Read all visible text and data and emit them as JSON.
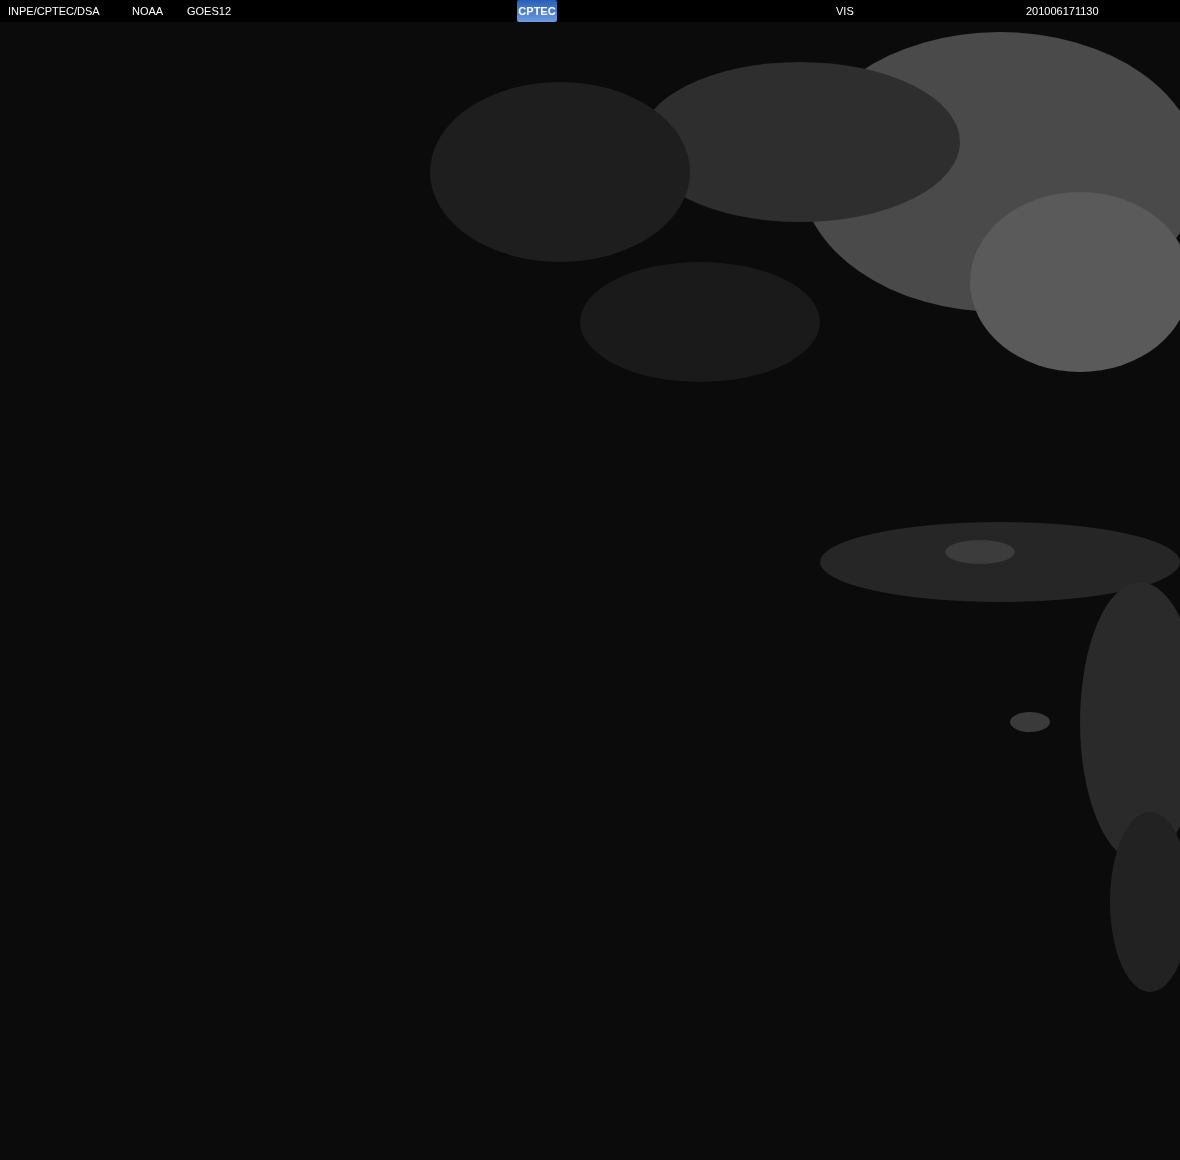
{
  "header": {
    "agency": "INPE/CPTEC/DSA",
    "source": "NOAA",
    "satellite": "GOES12",
    "logo": "CPTEC",
    "channel": "VIS",
    "timestamp": "201006171130"
  }
}
